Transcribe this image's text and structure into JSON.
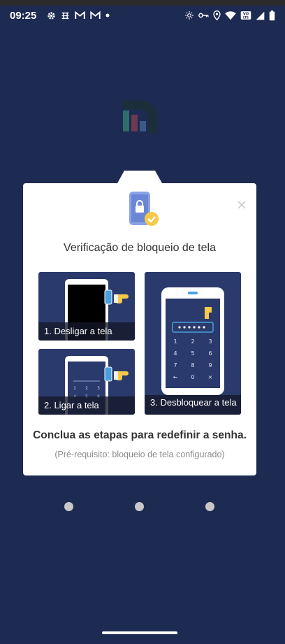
{
  "status_bar": {
    "time": "09:25",
    "left_icons": [
      "gear-icon",
      "grid-icon",
      "gmail-icon",
      "gmail-icon",
      "dot-icon"
    ],
    "right_icons": [
      "brightness-icon",
      "key-icon",
      "location-icon",
      "wifi-icon",
      "volte-icon",
      "signal-icon",
      "battery-icon"
    ]
  },
  "card": {
    "title": "Verificação de bloqueio de tela",
    "steps": [
      {
        "label": "1. Desligar a tela"
      },
      {
        "label": "2. Ligar a tela"
      },
      {
        "label": "3. Desbloquear a tela"
      }
    ],
    "keypad": [
      "1",
      "2",
      "3",
      "4",
      "5",
      "6",
      "7",
      "8",
      "9",
      "←",
      "0",
      "×"
    ],
    "main_message": "Conclua as etapas para redefinir a senha.",
    "sub_message": "(Pré-requisito: bloqueio de tela configurado)"
  },
  "colors": {
    "background": "#1d2a52",
    "card": "#ffffff",
    "step_panel": "#2b3a6c",
    "accent_blue": "#4a9fe0",
    "accent_yellow": "#f7c948"
  },
  "pager": {
    "count": 3
  }
}
